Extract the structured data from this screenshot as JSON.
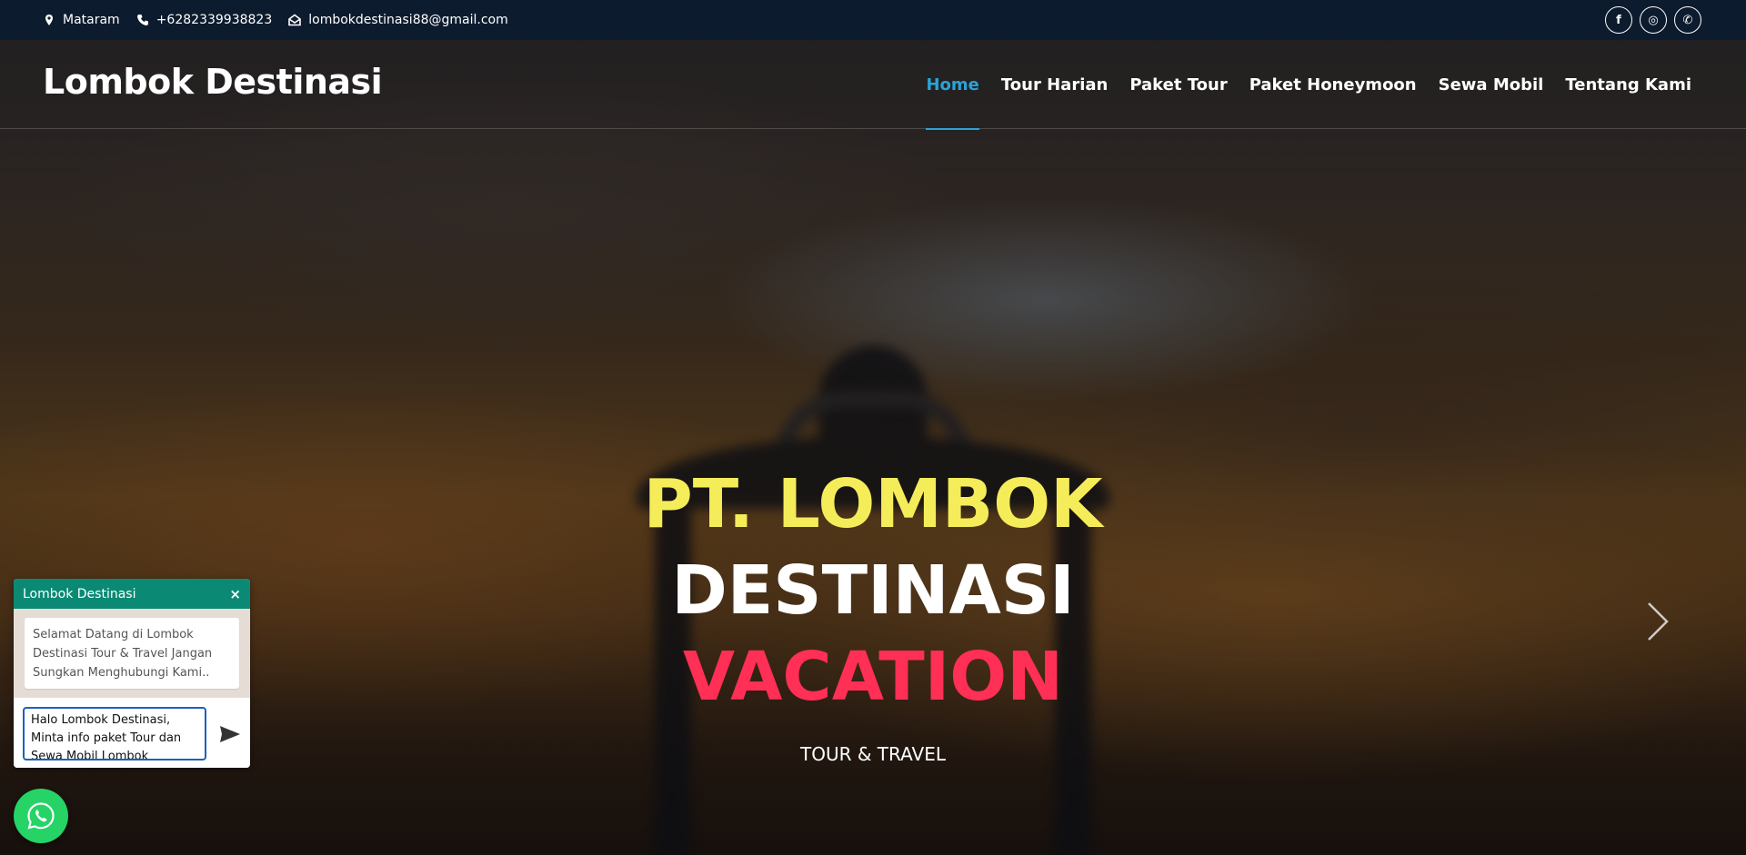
{
  "topbar": {
    "location": "Mataram",
    "phone": "+6282339938823",
    "email": "lombokdestinasi88@gmail.com",
    "social": [
      {
        "icon": "facebook-icon",
        "glyph": "f"
      },
      {
        "icon": "instagram-icon",
        "glyph": "◎"
      },
      {
        "icon": "whatsapp-icon",
        "glyph": "✆"
      }
    ]
  },
  "navbar": {
    "brand": "Lombok Destinasi",
    "menu": [
      {
        "label": "Home",
        "active": true
      },
      {
        "label": "Tour Harian",
        "active": false
      },
      {
        "label": "Paket Tour",
        "active": false
      },
      {
        "label": "Paket Honeymoon",
        "active": false
      },
      {
        "label": "Sewa Mobil",
        "active": false
      },
      {
        "label": "Tentang Kami",
        "active": false
      }
    ],
    "accent": "#2aa3d6"
  },
  "hero": {
    "line1": "PT. LOMBOK",
    "line2": "DESTINASI",
    "line3": "VACATION",
    "subtitle": "TOUR & TRAVEL",
    "colors": {
      "line1": "#f5ec5a",
      "line2": "#ffffff",
      "line3": "#ff2f55"
    }
  },
  "chat": {
    "title": "Lombok Destinasi",
    "close": "×",
    "welcome": "Selamat Datang di Lombok Destinasi Tour & Travel Jangan Sungkan Menghubungi Kami..",
    "input_value": "Halo Lombok Destinasi, Minta info paket Tour dan Sewa Mobil Lombok",
    "header_color": "#0a8a74"
  }
}
